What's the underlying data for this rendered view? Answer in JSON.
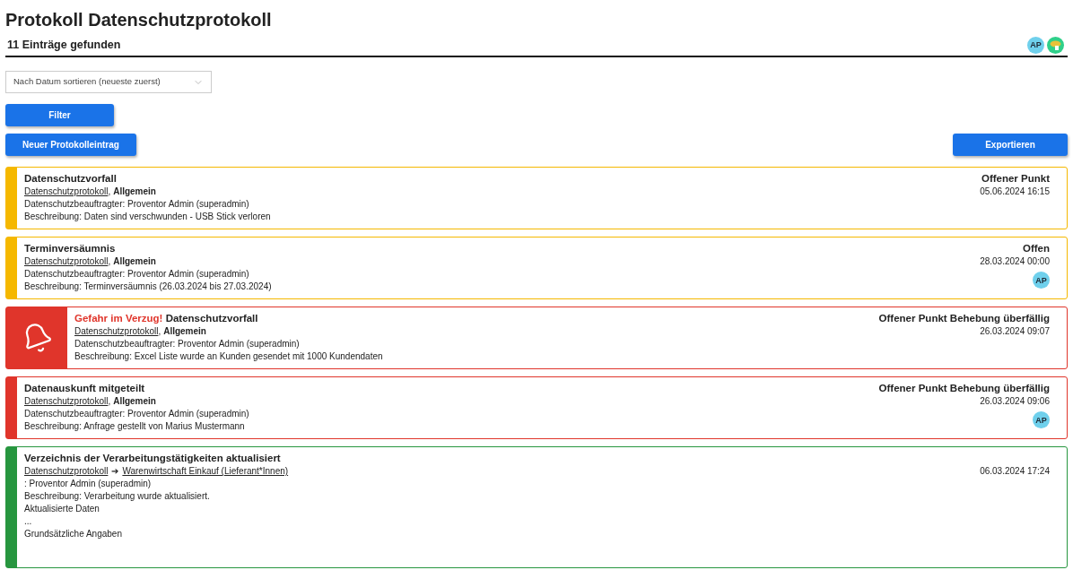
{
  "page": {
    "title": "Protokoll Datenschutzprotokoll",
    "count": "11 Einträge gefunden",
    "avatar": "AP"
  },
  "sort": {
    "value": "Nach Datum sortieren (neueste zuerst)"
  },
  "buttons": {
    "filter": "Filter",
    "new": "Neuer Protokolleintrag",
    "export": "Exportieren"
  },
  "entries": [
    {
      "color": "#f5b800",
      "kind": "normal",
      "title": "Datenschutzvorfall",
      "links": [
        "Datenschutzprotokoll"
      ],
      "category": "Allgemein",
      "lines": [
        "Datenschutzbeauftragter: Proventor Admin (superadmin)",
        "Beschreibung: Daten sind verschwunden - USB Stick verloren"
      ],
      "status": "Offener Punkt",
      "date": "05.06.2024 16:15",
      "comma": ","
    },
    {
      "color": "#f5b800",
      "kind": "normal",
      "title": "Terminversäumnis",
      "links": [
        "Datenschutzprotokoll"
      ],
      "category": "Allgemein",
      "lines": [
        "Datenschutzbeauftragter: Proventor Admin (superadmin)",
        "Beschreibung: Terminversäumnis (26.03.2024 bis 27.03.2024)"
      ],
      "status": "Offen",
      "date": "28.03.2024 00:00",
      "avatar": "AP",
      "comma": ","
    },
    {
      "color": "#e0352b",
      "kind": "alarm",
      "alert": "Gefahr im Verzug!",
      "title": "Datenschutzvorfall",
      "links": [
        "Datenschutzprotokoll"
      ],
      "category": "Allgemein",
      "lines": [
        "Datenschutzbeauftragter: Proventor Admin (superadmin)",
        "Beschreibung: Excel Liste wurde an Kunden gesendet mit 1000 Kundendaten"
      ],
      "status": "Offener Punkt Behebung überfällig",
      "date": "26.03.2024 09:07",
      "comma": ","
    },
    {
      "color": "#e0352b",
      "kind": "normal",
      "title": "Datenauskunft mitgeteilt",
      "links": [
        "Datenschutzprotokoll"
      ],
      "category": "Allgemein",
      "lines": [
        "Datenschutzbeauftragter: Proventor Admin (superadmin)",
        "Beschreibung: Anfrage gestellt von Marius Mustermann"
      ],
      "status": "Offener Punkt Behebung überfällig",
      "date": "26.03.2024 09:06",
      "avatar": "AP",
      "comma": ","
    },
    {
      "color": "#27963f",
      "kind": "normal",
      "title": "Verzeichnis der Verarbeitungstätigkeiten aktualisiert",
      "links": [
        "Datenschutzprotokoll",
        "Warenwirtschaft Einkauf (Lieferant*Innen)"
      ],
      "separator": "➔",
      "lines": [
        ": Proventor Admin (superadmin)",
        "Beschreibung: Verarbeitung wurde aktualisiert.",
        "Aktualisierte Daten",
        "...",
        "Grundsätzliche Angaben"
      ],
      "date": "06.03.2024 17:24"
    }
  ]
}
